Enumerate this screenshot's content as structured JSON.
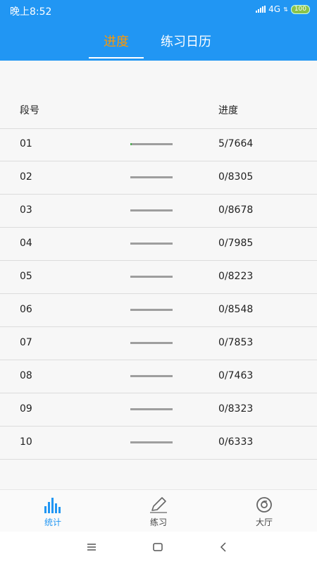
{
  "status_bar": {
    "time": "晚上8:52",
    "network": "4G",
    "battery": "100"
  },
  "header": {
    "tabs": [
      {
        "label": "进度",
        "active": true
      },
      {
        "label": "练习日历",
        "active": false
      }
    ]
  },
  "table": {
    "headers": {
      "segment": "段号",
      "progress": "进度"
    },
    "rows": [
      {
        "segment": "01",
        "progress_text": "5/7664",
        "fraction": 0.00065
      },
      {
        "segment": "02",
        "progress_text": "0/8305",
        "fraction": 0
      },
      {
        "segment": "03",
        "progress_text": "0/8678",
        "fraction": 0
      },
      {
        "segment": "04",
        "progress_text": "0/7985",
        "fraction": 0
      },
      {
        "segment": "05",
        "progress_text": "0/8223",
        "fraction": 0
      },
      {
        "segment": "06",
        "progress_text": "0/8548",
        "fraction": 0
      },
      {
        "segment": "07",
        "progress_text": "0/7853",
        "fraction": 0
      },
      {
        "segment": "08",
        "progress_text": "0/7463",
        "fraction": 0
      },
      {
        "segment": "09",
        "progress_text": "0/8323",
        "fraction": 0
      },
      {
        "segment": "10",
        "progress_text": "0/6333",
        "fraction": 0
      }
    ]
  },
  "bottom_nav": {
    "items": [
      {
        "label": "统计",
        "icon": "bar-chart-icon",
        "active": true
      },
      {
        "label": "练习",
        "icon": "pencil-icon",
        "active": false
      },
      {
        "label": "大厅",
        "icon": "disc-icon",
        "active": false
      }
    ]
  },
  "system_nav": {
    "icons": [
      "menu-icon",
      "home-icon",
      "back-icon"
    ]
  },
  "colors": {
    "primary": "#2196f3",
    "active_tab": "#ff9800",
    "bar_track": "#9e9e9e",
    "bar_fill": "#4caf50"
  }
}
